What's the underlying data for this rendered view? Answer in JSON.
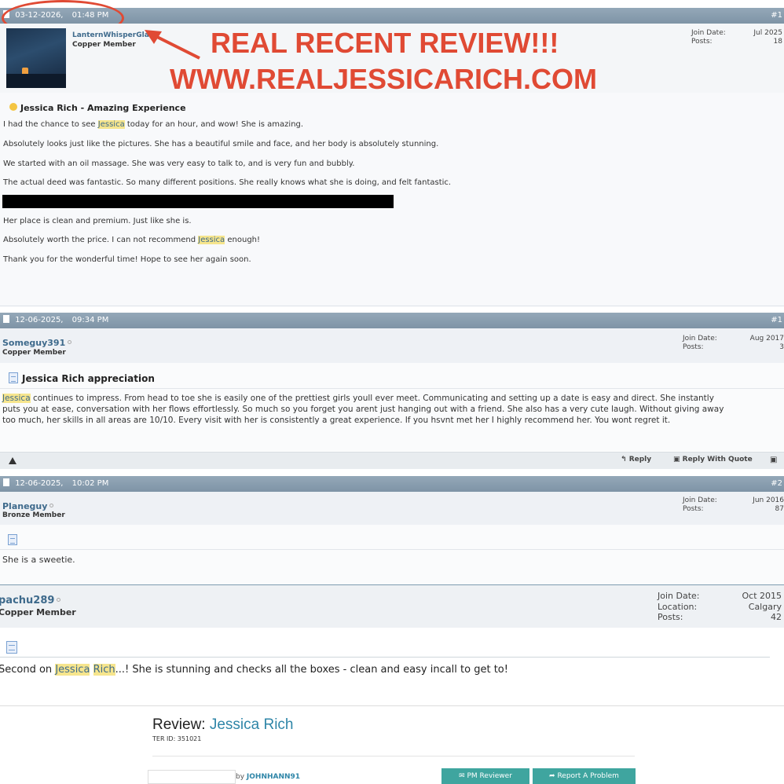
{
  "post1": {
    "date": "03-12-2026,",
    "time": "01:48 PM",
    "num": "#1",
    "username": "LanternWhisperGlade",
    "rank": "Copper Member",
    "join_label": "Join Date:",
    "join_value": "Jul 2025",
    "posts_label": "Posts:",
    "posts_value": "18",
    "title": "Jessica Rich - Amazing Experience",
    "lines": [
      [
        "I had the chance to see ",
        "Jessica",
        " today for an hour, and wow! She is amazing."
      ],
      "Absolutely looks just like the pictures. She has a beautiful smile and face, and her body is absolutely stunning.",
      "We started with an oil massage. She was very easy to talk to, and is very fun and bubbly.",
      "The actual deed was fantastic. So many different positions. She really knows what she is doing, and felt fantastic.",
      "Her place is clean and premium. Just like she is.",
      [
        "Absolutely worth the price. I can not recommend ",
        "Jessica",
        " enough!"
      ],
      "Thank you for the wonderful time! Hope to see her again soon."
    ]
  },
  "annotation": {
    "line1": "REAL RECENT REVIEW!!!",
    "line2": "WWW.REALJESSICARICH.COM"
  },
  "post2": {
    "date": "12-06-2025,",
    "time": "09:34 PM",
    "num": "#1",
    "username": "Someguy391",
    "rank": "Copper Member",
    "join_label": "Join Date:",
    "join_value": "Aug 2017",
    "posts_label": "Posts:",
    "posts_value": "3",
    "title": "Jessica Rich appreciation",
    "hl": "Jessica",
    "line1": " continues to impress. From head to toe she is easily one of the prettiest girls youll ever meet. Communicating and setting up a date is easy and direct. She instantly",
    "line2": "puts you at ease, conversation with her flows effortlessly. So much so you forget you arent just hanging out with a friend. She also has a very cute laugh. Without giving away",
    "line3": "too much, her skills in all areas are 10/10. Every visit with her is consistently a great experience. If you hsvnt met her I highly recommend her. You wont regret it.",
    "reply": "Reply",
    "reply_quote": "Reply With Quote"
  },
  "post3": {
    "date": "12-06-2025,",
    "time": "10:02 PM",
    "num": "#2",
    "username": "Planeguy",
    "rank": "Bronze Member",
    "join_label": "Join Date:",
    "join_value": "Jun 2016",
    "posts_label": "Posts:",
    "posts_value": "87",
    "text": "She is a sweetie."
  },
  "post4": {
    "username": "pachu289",
    "rank": "Copper Member",
    "join_label": "Join Date:",
    "join_value": "Oct 2015",
    "location_label": "Location:",
    "location_value": "Calgary",
    "posts_label": "Posts:",
    "posts_value": "42",
    "text_pre": "Second on ",
    "hl1": "Jessica",
    "hl2": "Rich",
    "text_post": "...! She is stunning and checks all the boxes - clean and easy incall to get to!"
  },
  "review": {
    "prefix": "Review: ",
    "name": "Jessica Rich",
    "ter_id": "TER ID: 351021",
    "by": "by",
    "author": "JOHNHANN91",
    "pm": "PM Reviewer",
    "report": "Report A Problem"
  },
  "colors": {
    "accent_red": "#e04a34",
    "link_blue": "#3e6a8c",
    "header_blue": "#8ea2b4",
    "teal": "#3fa59f"
  }
}
